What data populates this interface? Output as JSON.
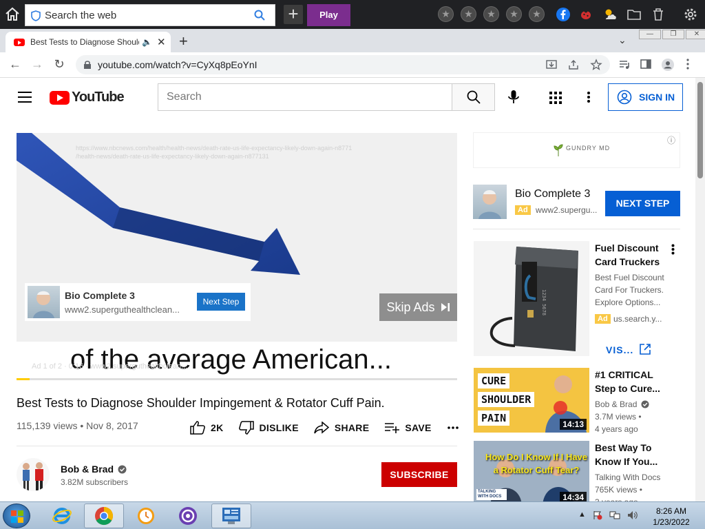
{
  "os_toolbar": {
    "search_placeholder": "Search the web",
    "play_label": "Play"
  },
  "browser": {
    "tab_title": "Best Tests to Diagnose Shoulder Impingement & Rotator Cuff Pain",
    "url": "youtube.com/watch?v=CyXq8pEoYnI"
  },
  "youtube": {
    "logo_text": "YouTube",
    "search_placeholder": "Search",
    "sign_in_label": "SIGN IN"
  },
  "player": {
    "watermark_url": "https://www.nbcnews.com/health/health-news/death-rate-us-life-expectancy-likely-down-again-n8771",
    "watermark_url2": "/health-news/death-rate-us-life-expectancy-likely-down-again-n877131",
    "caption": "of the average American...",
    "ad_info": "Ad 1 of 2 · 0:16 · www2.superguthealthclean...",
    "overlay_ad": {
      "name": "Bio Complete 3",
      "site": "www2.superguthealthclean...",
      "button": "Next Step"
    },
    "skip_label": "Skip Ads",
    "progress_fraction": 0.03
  },
  "video": {
    "title": "Best Tests to Diagnose Shoulder Impingement & Rotator Cuff Pain.",
    "views": "115,139 views",
    "date": "Nov 8, 2017",
    "likes": "2K",
    "dislike_label": "DISLIKE",
    "share_label": "SHARE",
    "save_label": "SAVE"
  },
  "channel": {
    "name": "Bob & Brad",
    "subscribers": "3.82M subscribers",
    "subscribe_label": "SUBSCRIBE"
  },
  "sidebar": {
    "banner_brand": "GUNDRY MD",
    "ad_card": {
      "name": "Bio Complete 3",
      "badge": "Ad",
      "site": "www2.supergu...",
      "button": "NEXT STEP"
    },
    "fuel_ad": {
      "title": "Fuel Discount Card Truckers",
      "description": "Best Fuel Discount Card For Truckers. Explore Options...",
      "badge": "Ad",
      "site": "us.search.y...",
      "visit_label": "VIS..."
    },
    "recs": [
      {
        "title": "#1 CRITICAL Step to Cure...",
        "channel": "Bob & Brad",
        "views": "3.7M views •",
        "age": "4 years ago",
        "duration": "14:13",
        "thumb_words": [
          "CURE",
          "SHOULDER",
          "PAIN"
        ]
      },
      {
        "title": "Best Way To Know If You...",
        "channel": "Talking With Docs",
        "views": "765K views •",
        "age": "3 years ago",
        "duration": "14:34",
        "thumb_text": "How Do I Know If I Have a Rotator Cuff Tear?",
        "thumb_logo": "TALKING WITH DOCS"
      }
    ]
  },
  "taskbar": {
    "time": "8:26 AM",
    "date": "1/23/2022"
  }
}
